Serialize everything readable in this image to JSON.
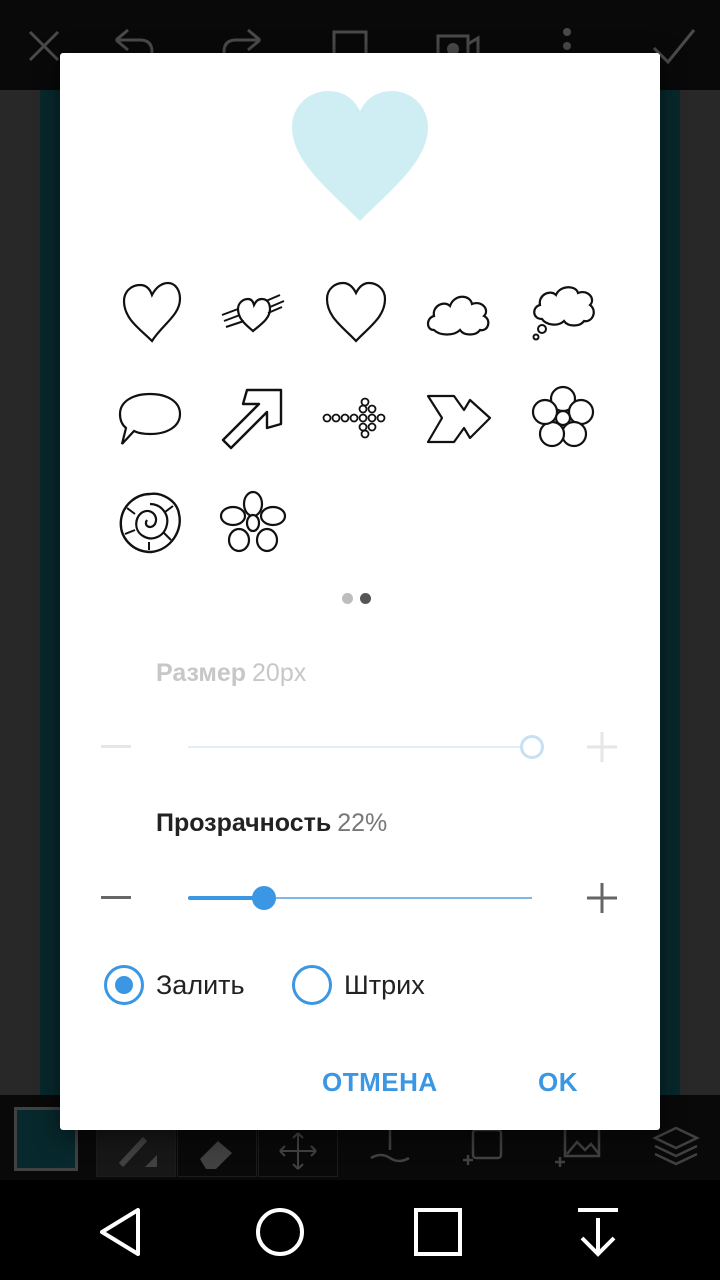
{
  "top_icons": [
    "close-icon",
    "undo-icon",
    "redo-icon",
    "crop-icon",
    "camera-icon",
    "more-vert-icon",
    "check-icon"
  ],
  "colors": {
    "accent": "#3b97e3",
    "preview_fill": "#cfeef3",
    "canvas": "#0d4a50",
    "dialog_bg": "#ffffff"
  },
  "preview": {
    "shape": "heart"
  },
  "shapes": [
    "heart-icon",
    "winged-heart-icon",
    "heart-outline-icon",
    "cloud-icon",
    "thought-bubble-icon",
    "speech-bubble-icon",
    "arrow-up-right-icon",
    "dotted-arrow-icon",
    "fish-arrow-icon",
    "flower-icon",
    "rose-icon",
    "daisy-icon"
  ],
  "pager": {
    "page": 2,
    "total": 2
  },
  "size": {
    "label": "Размер",
    "value": "20px",
    "level": 1.0
  },
  "opacity": {
    "label": "Прозрачность",
    "value": "22%",
    "level": 0.22
  },
  "mode": {
    "options": [
      {
        "label": "Залить",
        "selected": true
      },
      {
        "label": "Штрих",
        "selected": false
      }
    ]
  },
  "buttons": {
    "cancel": "ОТМЕНА",
    "ok": "OK"
  },
  "toolbar_icons": [
    "brush-icon",
    "eraser-icon",
    "move-icon",
    "text-icon",
    "add-sticker-icon",
    "add-photo-icon",
    "layers-icon"
  ],
  "nav": [
    "back-icon",
    "home-icon",
    "recents-icon",
    "hide-keyboard-icon"
  ]
}
